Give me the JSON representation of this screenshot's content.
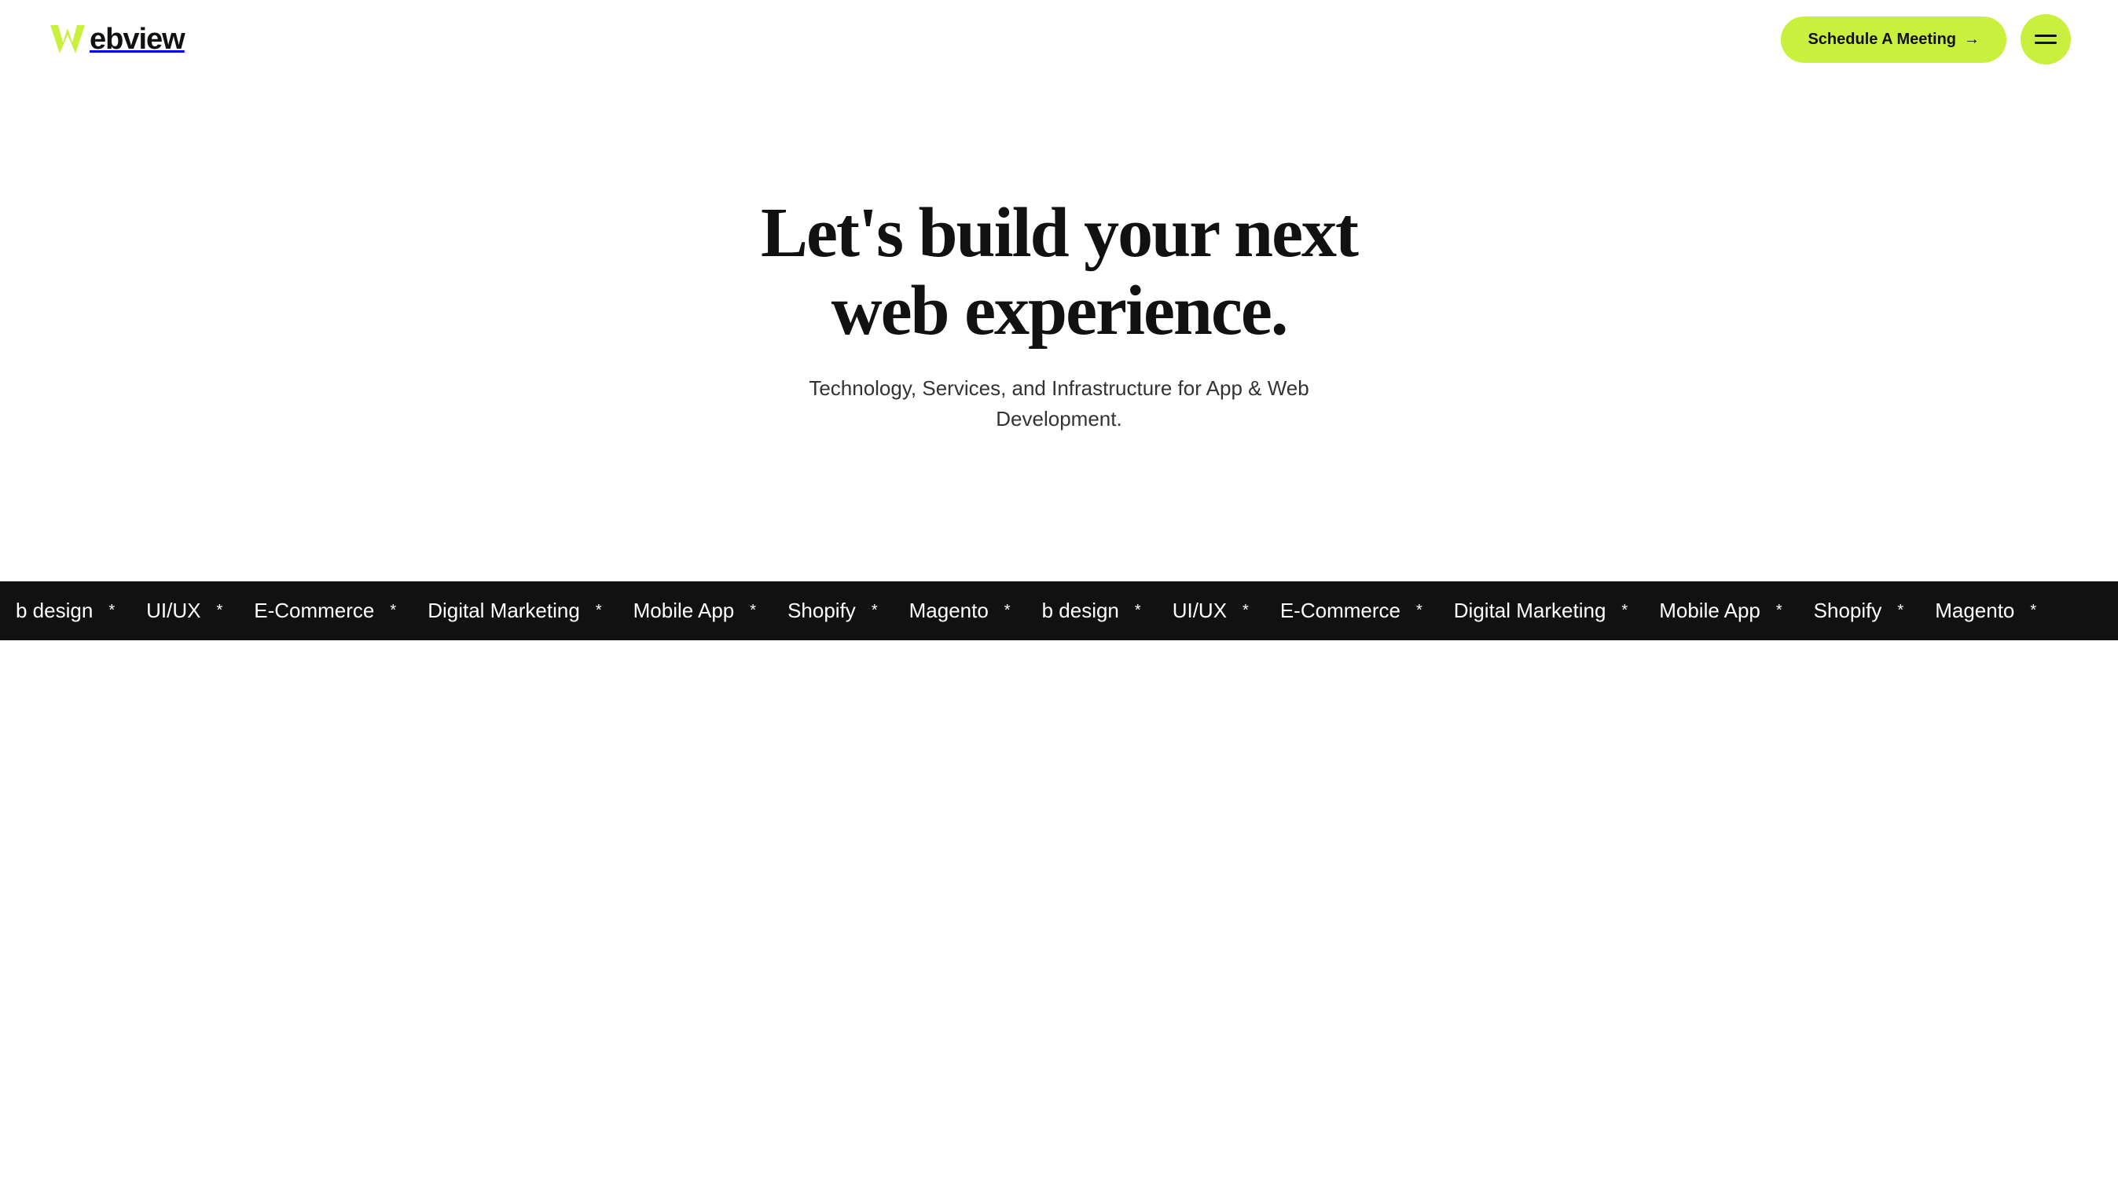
{
  "header": {
    "logo": {
      "text": "ebview",
      "icon_color": "#c8f03c"
    },
    "schedule_btn": {
      "label": "Schedule A Meeting",
      "arrow": "→"
    },
    "menu_btn": {
      "aria_label": "Open Menu"
    }
  },
  "hero": {
    "title": "Let's build your next web experience.",
    "subtitle": "Technology, Services, and Infrastructure for App & Web Development."
  },
  "ticker": {
    "items": [
      "b design",
      "UI/UX",
      "E-Commerce",
      "Digital Marketing",
      "Mobile App",
      "Shopify",
      "Magento",
      "b design",
      "UI/UX",
      "E-Commerce",
      "Digital Marketing",
      "Mobile App",
      "Shopify",
      "Magento"
    ]
  },
  "colors": {
    "accent": "#c8f03c",
    "dark": "#111111",
    "white": "#ffffff"
  }
}
